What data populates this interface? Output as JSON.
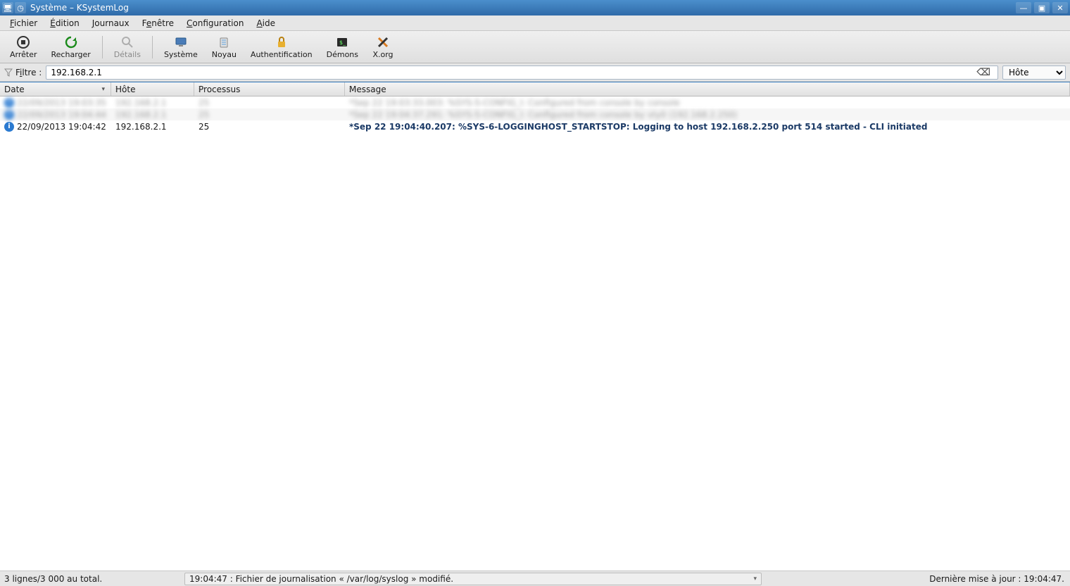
{
  "window": {
    "title": "Système – KSystemLog"
  },
  "menubar": {
    "file": {
      "label": "Fichier",
      "hotkey_index": 0
    },
    "edit": {
      "label": "Édition",
      "hotkey_index": 0
    },
    "logs": {
      "label": "Journaux",
      "hotkey_index": 0
    },
    "window": {
      "label": "Fenêtre",
      "hotkey_index": 1
    },
    "config": {
      "label": "Configuration",
      "hotkey_index": 0
    },
    "help": {
      "label": "Aide",
      "hotkey_index": 0
    }
  },
  "toolbar": {
    "stop": "Arrêter",
    "reload": "Recharger",
    "details": "Détails",
    "system": "Système",
    "kernel": "Noyau",
    "auth": "Authentification",
    "daemons": "Démons",
    "xorg": "X.org"
  },
  "filter": {
    "label": "Filtre :",
    "value": "192.168.2.1",
    "column_selected": "Hôte"
  },
  "columns": {
    "date": "Date",
    "host": "Hôte",
    "process": "Processus",
    "message": "Message"
  },
  "rows": [
    {
      "blur": true,
      "date": "22/09/2013 19:03:35",
      "host": "192.168.2.1",
      "proc": "25",
      "msg": "*Sep 22 19:03:33.003: %SYS-5-CONFIG_I: Configured from console by console"
    },
    {
      "blur": true,
      "date": "22/09/2013 19:04:44",
      "host": "192.168.2.1",
      "proc": "25",
      "msg": "*Sep 22 19:04:37.291: %SYS-5-CONFIG_I: Configured from console by vty0 (192.168.2.250)"
    },
    {
      "blur": false,
      "bold": true,
      "date": "22/09/2013 19:04:42",
      "host": "192.168.2.1",
      "proc": "25",
      "msg": "*Sep 22 19:04:40.207: %SYS-6-LOGGINGHOST_STARTSTOP: Logging to host 192.168.2.250 port 514 started - CLI initiated"
    }
  ],
  "status": {
    "count": "3 lignes/3 000 au total.",
    "message": "19:04:47 : Fichier de journalisation « /var/log/syslog » modifié.",
    "last_update": "Dernière mise à jour : 19:04:47."
  }
}
